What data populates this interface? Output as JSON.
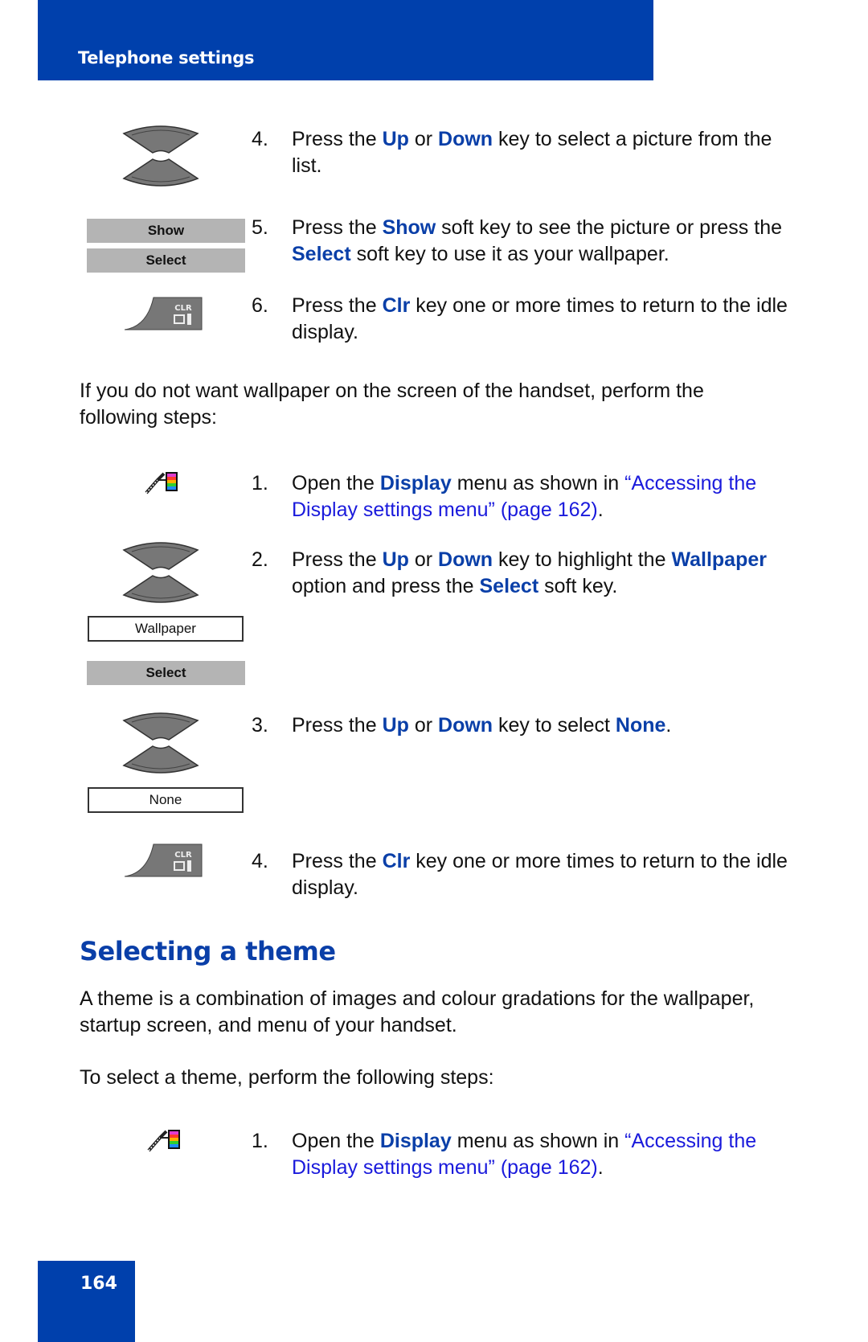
{
  "header": {
    "title": "Telephone settings"
  },
  "footer": {
    "page_number": "164"
  },
  "section1": {
    "steps": [
      {
        "num": "4.",
        "parts": [
          {
            "t": "Press the "
          },
          {
            "t": "Up",
            "s": "b"
          },
          {
            "t": " or "
          },
          {
            "t": "Down",
            "s": "b"
          },
          {
            "t": " key to select a picture from the list."
          }
        ]
      },
      {
        "num": "5.",
        "parts": [
          {
            "t": "Press the "
          },
          {
            "t": "Show",
            "s": "b"
          },
          {
            "t": " soft key to see the picture or press the "
          },
          {
            "t": "Select",
            "s": "b"
          },
          {
            "t": " soft key to use it as your wallpaper."
          }
        ]
      },
      {
        "num": "6.",
        "parts": [
          {
            "t": "Press the "
          },
          {
            "t": "Clr",
            "s": "b"
          },
          {
            "t": " key one or more times to return to the idle display."
          }
        ]
      }
    ],
    "softkeys": {
      "show": "Show",
      "select": "Select"
    }
  },
  "no_wallpaper_intro": "If you do not want wallpaper on the screen of the handset, perform the following steps:",
  "section2": {
    "steps": [
      {
        "num": "1.",
        "parts": [
          {
            "t": "Open the "
          },
          {
            "t": "Display",
            "s": "b"
          },
          {
            "t": " menu as shown in "
          },
          {
            "t": "“Accessing the Display settings menu” (page 162)",
            "s": "lnk"
          },
          {
            "t": "."
          }
        ]
      },
      {
        "num": "2.",
        "parts": [
          {
            "t": "Press the "
          },
          {
            "t": "Up",
            "s": "b"
          },
          {
            "t": " or "
          },
          {
            "t": "Down",
            "s": "b"
          },
          {
            "t": " key to highlight the "
          },
          {
            "t": "Wallpaper",
            "s": "b"
          },
          {
            "t": " option and press the "
          },
          {
            "t": "Select",
            "s": "b"
          },
          {
            "t": " soft key."
          }
        ]
      },
      {
        "num": "3.",
        "parts": [
          {
            "t": "Press the "
          },
          {
            "t": "Up",
            "s": "b"
          },
          {
            "t": " or "
          },
          {
            "t": "Down",
            "s": "b"
          },
          {
            "t": " key to select "
          },
          {
            "t": "None",
            "s": "b"
          },
          {
            "t": "."
          }
        ]
      },
      {
        "num": "4.",
        "parts": [
          {
            "t": "Press the "
          },
          {
            "t": "Clr",
            "s": "b"
          },
          {
            "t": " key one or more times to return to the idle display."
          }
        ]
      }
    ],
    "display_wallpaper": "Wallpaper",
    "softkey_select": "Select",
    "display_none": "None"
  },
  "theme_section": {
    "heading": "Selecting a theme",
    "description": "A theme is a combination of images and colour gradations for the wallpaper, startup screen, and menu of your handset.",
    "intro": "To select a theme, perform the following steps:",
    "steps": [
      {
        "num": "1.",
        "parts": [
          {
            "t": "Open the "
          },
          {
            "t": "Display",
            "s": "b"
          },
          {
            "t": " menu as shown in "
          },
          {
            "t": "“Accessing the Display settings menu” (page 162)",
            "s": "lnk"
          },
          {
            "t": "."
          }
        ]
      }
    ]
  },
  "icons": {
    "clr_label": "CLR"
  },
  "colors": {
    "brand_blue": "#0040ac",
    "emphasis_blue": "#0a3fa8",
    "link_blue": "#1a1adc",
    "softkey_gray": "#b4b4b4"
  }
}
